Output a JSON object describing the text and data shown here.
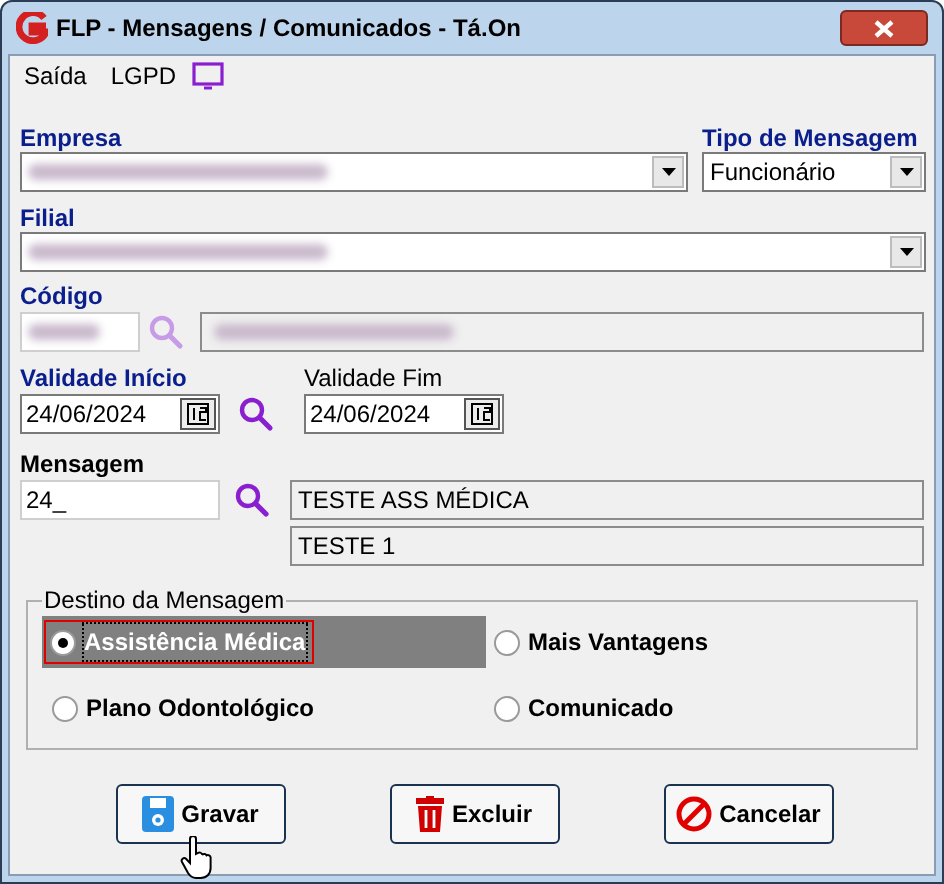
{
  "window": {
    "title": "FLP - Mensagens / Comunicados - Tá.On"
  },
  "menu": [
    {
      "label": "Saída"
    },
    {
      "label": "LGPD"
    }
  ],
  "empresa": {
    "label": "Empresa",
    "required": true,
    "bold": true,
    "blurred": true
  },
  "tipo": {
    "label": "Tipo de Mensagem",
    "required": true,
    "bold": true,
    "value": "Funcionário"
  },
  "filial": {
    "label": "Filial",
    "required": true,
    "bold": true,
    "blurred": true
  },
  "codigo": {
    "label": "Código",
    "required": true,
    "bold": true,
    "blurred": true,
    "description_blurred": true
  },
  "validade_inicio": {
    "label": "Validade Início",
    "required": true,
    "bold": true,
    "value": "24/06/2024"
  },
  "validade_fim": {
    "label": "Validade Fim",
    "required": false,
    "bold": false,
    "value": "24/06/2024"
  },
  "mensagem": {
    "label": "Mensagem",
    "required": false,
    "bold": true,
    "value": "24_",
    "lines": [
      "TESTE ASS MÉDICA",
      "TESTE 1"
    ]
  },
  "destino": {
    "title": "Destino da Mensagem",
    "options": [
      {
        "label": "Assistência Médica",
        "selected": true,
        "focused": true
      },
      {
        "label": "Mais Vantagens",
        "selected": false,
        "focused": false
      },
      {
        "label": "Plano Odontológico",
        "selected": false,
        "focused": false
      },
      {
        "label": "Comunicado",
        "selected": false,
        "focused": false
      }
    ]
  },
  "buttons": [
    {
      "label": "Gravar",
      "kind": "save"
    },
    {
      "label": "Excluir",
      "kind": "delete"
    },
    {
      "label": "Cancelar",
      "kind": "cancel"
    }
  ]
}
